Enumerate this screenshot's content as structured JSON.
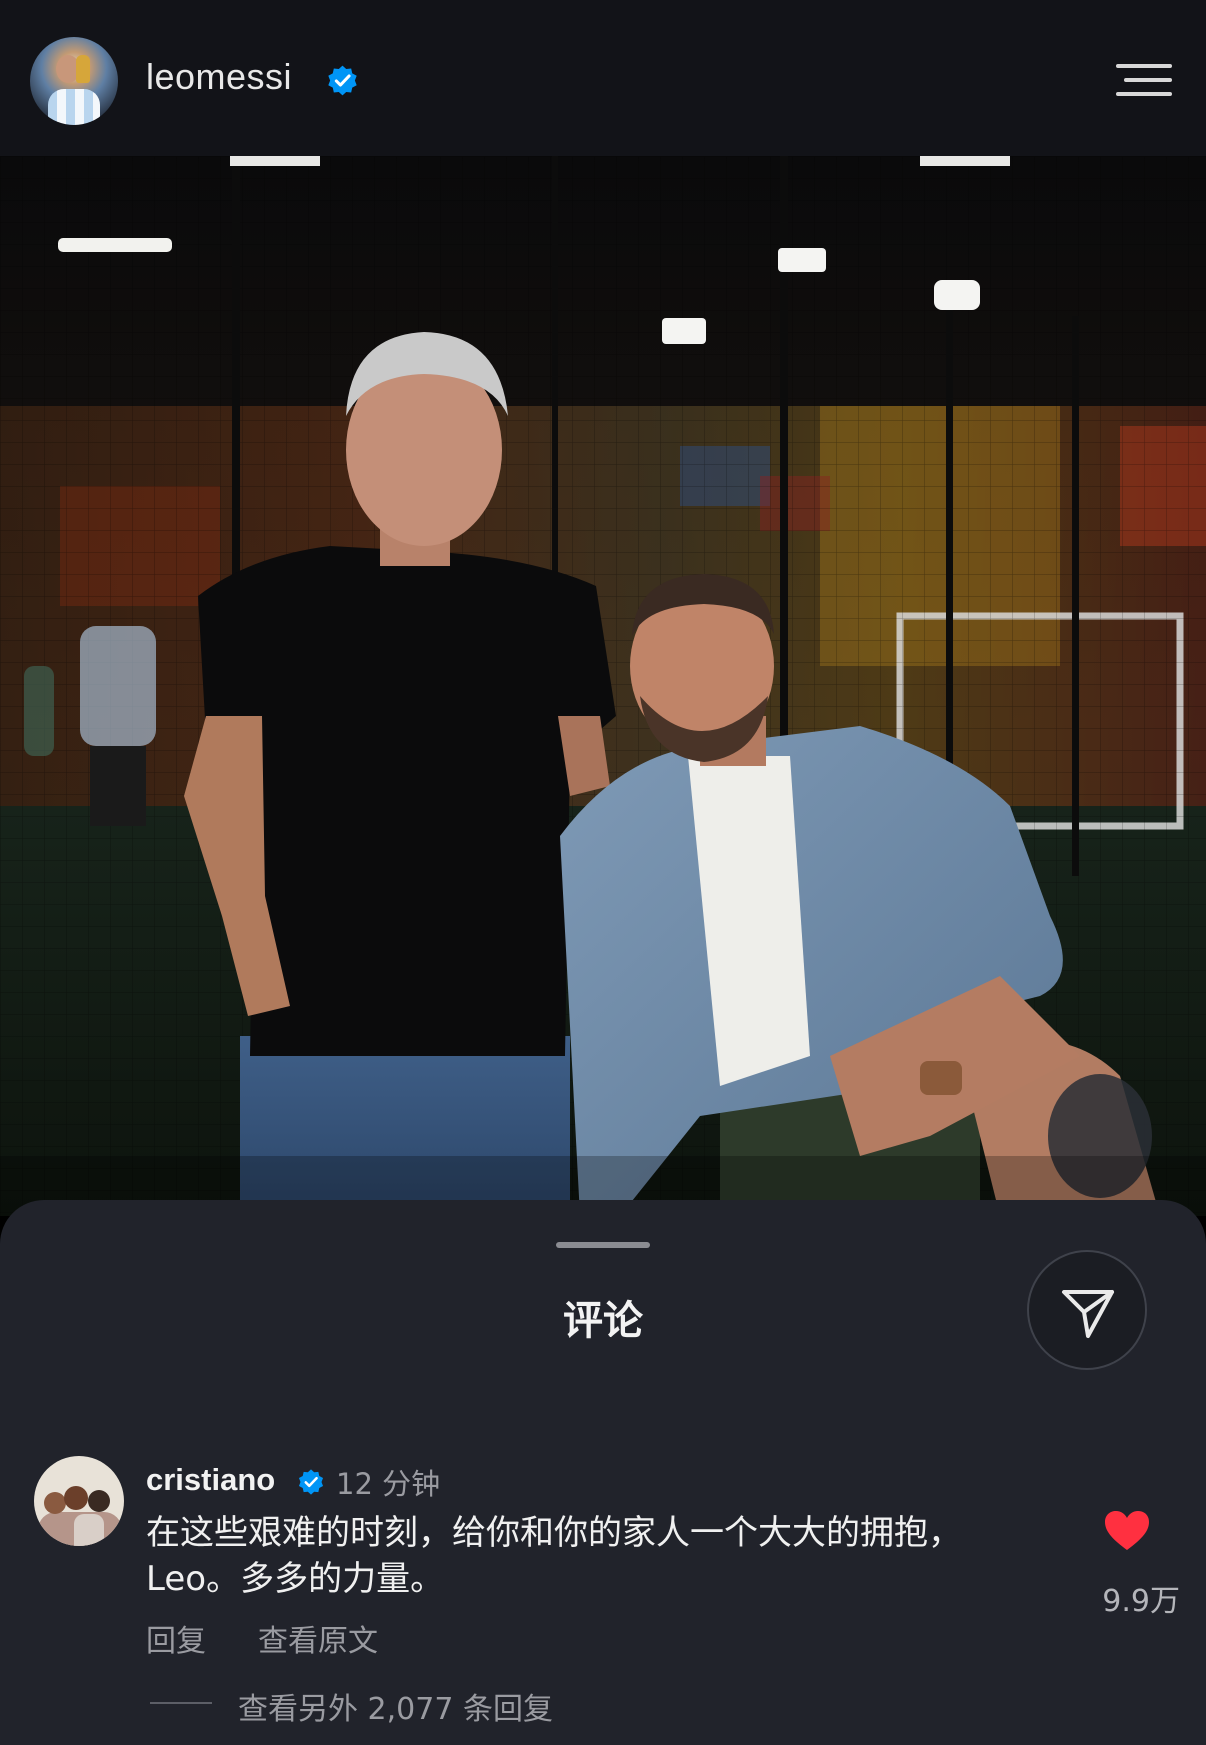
{
  "header": {
    "username": "leomessi",
    "verified": true
  },
  "colors": {
    "background": "#121318",
    "sheet": "#21232b",
    "verified_blue": "#0095f6",
    "like_red": "#ff3040",
    "muted_text": "#9a9ba1"
  },
  "icons": {
    "profile_avatar": "avatar",
    "verified": "verified-badge-icon",
    "menu": "hamburger-menu-icon",
    "share": "paper-plane-icon",
    "like": "heart-icon"
  },
  "comments_sheet": {
    "title": "评论",
    "comment": {
      "username": "cristiano",
      "verified": true,
      "time": "12 分钟",
      "text": "在这些艰难的时刻，给你和你的家人一个大大的拥抱，Leo。多多的力量。",
      "reply_label": "回复",
      "see_translation_label": "查看原文",
      "likes": "9.9万",
      "liked": true,
      "view_replies_label": "查看另外 2,077 条回复"
    }
  }
}
